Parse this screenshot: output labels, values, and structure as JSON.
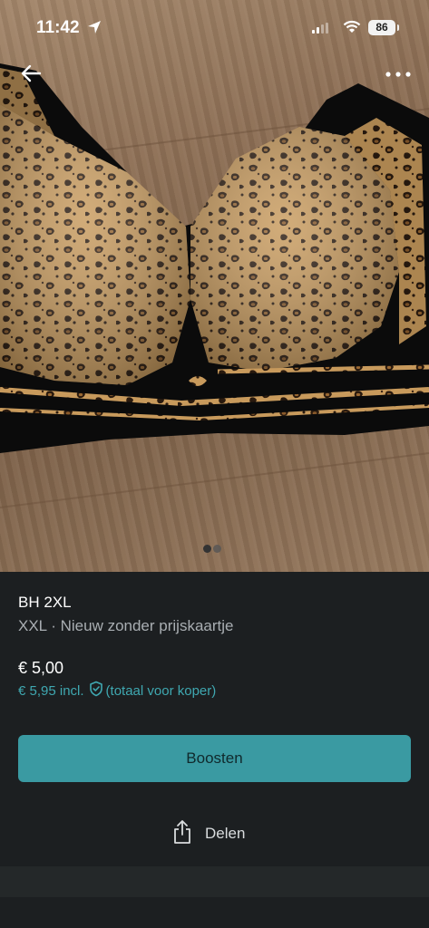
{
  "status_bar": {
    "time": "11:42",
    "battery": "86"
  },
  "product": {
    "title": "BH 2XL",
    "subtitle": "XXL · Nieuw zonder prijskaartje",
    "price": "€ 5,00",
    "price_incl": "€ 5,95 incl.",
    "price_incl_note": "(totaal voor koper)"
  },
  "actions": {
    "boost_label": "Boosten",
    "share_label": "Delen"
  },
  "colors": {
    "accent": "#3a9aa2",
    "accent_text": "#3fa8b1",
    "background": "#1c1f21",
    "secondary_text": "#a9aeb2"
  },
  "carousel": {
    "image_count": 2,
    "active_index": 1
  }
}
